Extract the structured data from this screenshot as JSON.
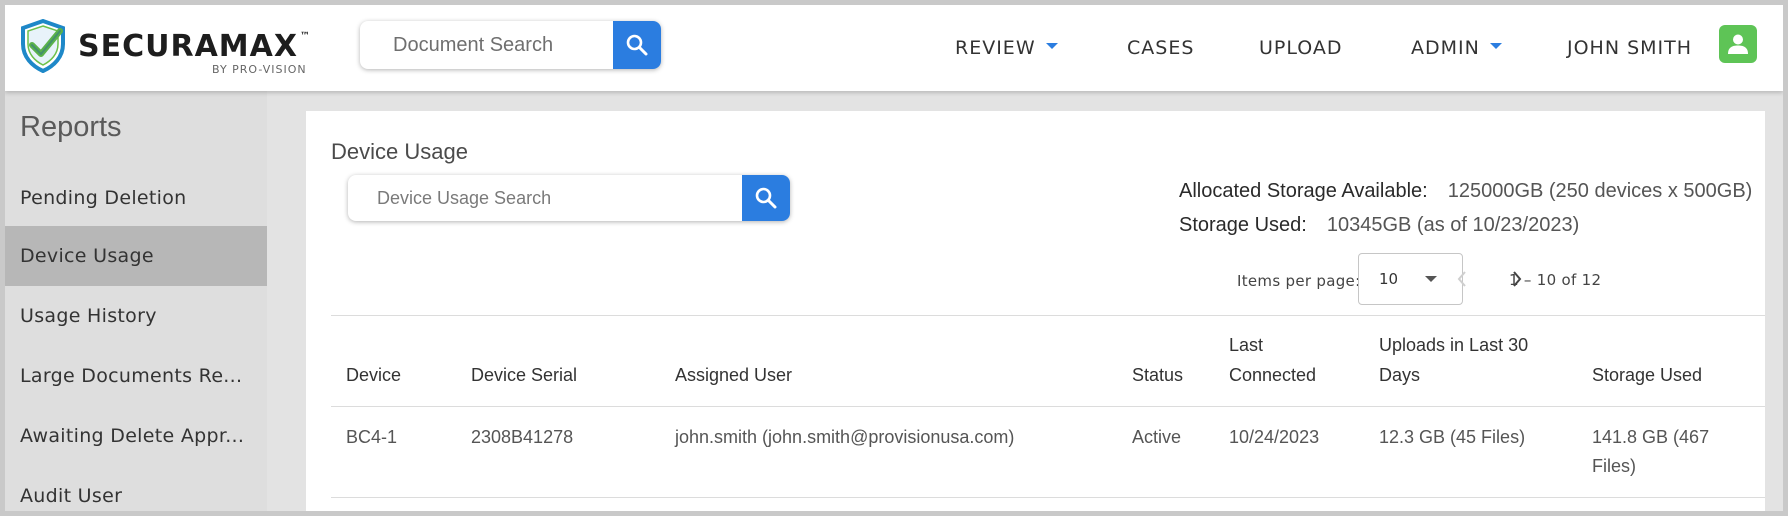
{
  "header": {
    "logo_name": "SECURAMAX",
    "logo_tm": "™",
    "logo_sub": "BY PRO-VISION",
    "search_placeholder": "Document Search",
    "nav": {
      "review": "REVIEW",
      "cases": "CASES",
      "upload": "UPLOAD",
      "admin": "ADMIN",
      "user": "JOHN SMITH"
    },
    "accent": "#2b7de0",
    "avatar_color": "#5ec456"
  },
  "sidebar": {
    "title": "Reports",
    "items": [
      {
        "label": "Pending Deletion",
        "active": false
      },
      {
        "label": "Device Usage",
        "active": true
      },
      {
        "label": "Usage History",
        "active": false
      },
      {
        "label": "Large Documents Re...",
        "active": false
      },
      {
        "label": "Awaiting Delete Appr...",
        "active": false
      },
      {
        "label": "Audit User",
        "active": false
      }
    ]
  },
  "main": {
    "title": "Device Usage",
    "search_placeholder": "Device Usage Search",
    "allocated_label": "Allocated Storage Available:",
    "allocated_value": "125000GB (250 devices x 500GB)",
    "used_label": "Storage Used:",
    "used_value": "10345GB (as of 10/23/2023)",
    "items_per_page_label": "Items per page:",
    "items_per_page_value": "10",
    "range_label": "1 – 10 of 12",
    "table": {
      "headers": {
        "device": "Device",
        "serial": "Device Serial",
        "user": "Assigned User",
        "status": "Status",
        "last_connected_1": "Last",
        "last_connected_2": "Connected",
        "uploads_1": "Uploads in Last 30",
        "uploads_2": "Days",
        "storage": "Storage Used"
      },
      "rows": [
        {
          "device": "BC4-1",
          "serial": "2308B41278",
          "user": "john.smith (john.smith@provisionusa.com)",
          "status": "Active",
          "last_connected": "10/24/2023",
          "uploads": "12.3 GB (45 Files)",
          "storage_1": "141.8 GB (467",
          "storage_2": "Files)"
        }
      ]
    }
  }
}
